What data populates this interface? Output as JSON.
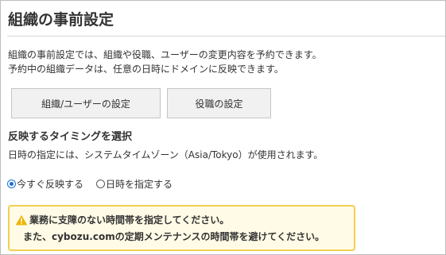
{
  "page": {
    "title": "組織の事前設定",
    "description_lines": [
      "組織の事前設定では、組織や役職、ユーザーの変更内容を予約できます。",
      "予約中の組織データは、任意の日時にドメインに反映できます。"
    ]
  },
  "buttons": {
    "org_user_settings": "組織/ユーザーの設定",
    "title_settings": "役職の設定"
  },
  "timing": {
    "heading": "反映するタイミングを選択",
    "description": "日時の指定には、システムタイムゾーン（Asia/Tokyo）が使用されます。",
    "options": [
      {
        "label": "今すぐ反映する",
        "checked": true
      },
      {
        "label": "日時を指定する",
        "checked": false
      }
    ]
  },
  "warning": {
    "line1": "業務に支障のない時間帯を指定してください。",
    "line2": "また、cybozu.comの定期メンテナンスの時間帯を避けてください。",
    "icon": "warning-triangle-icon",
    "border_color": "#f3cf4f",
    "background_color": "#fffbe6"
  },
  "colors": {
    "accent": "#1a6fd6",
    "text": "#333333"
  }
}
